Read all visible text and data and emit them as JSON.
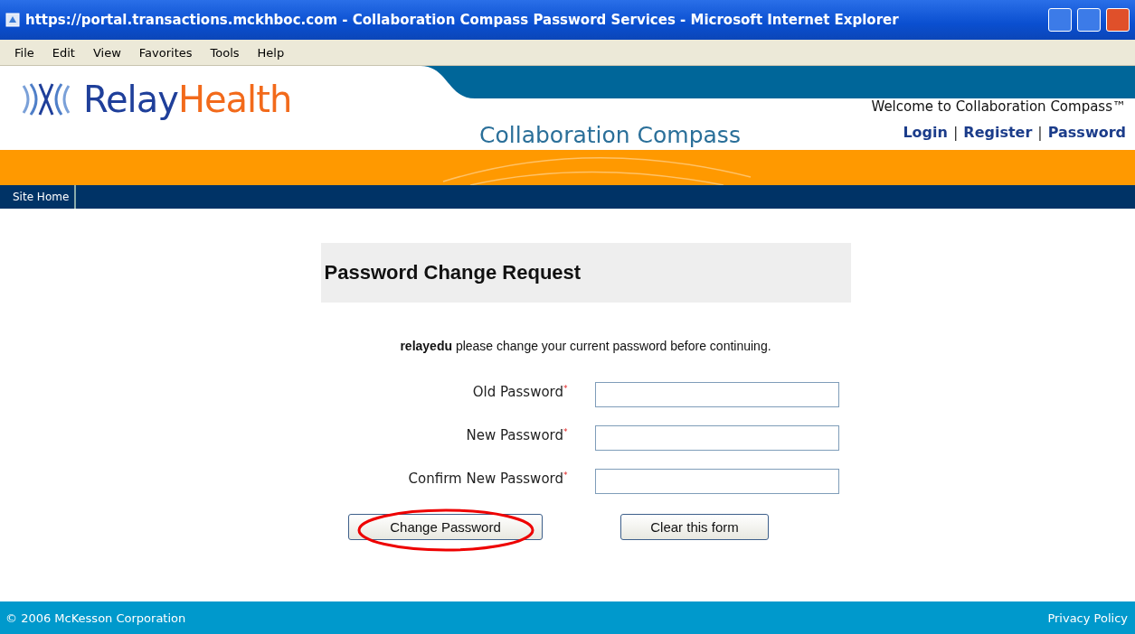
{
  "window": {
    "title": "https://portal.transactions.mckhboc.com - Collaboration Compass Password Services - Microsoft Internet Explorer"
  },
  "menu": [
    "File",
    "Edit",
    "View",
    "Favorites",
    "Tools",
    "Help"
  ],
  "header": {
    "logo_first": "Relay",
    "logo_second": "Health",
    "site_title": "Collaboration Compass",
    "welcome": "Welcome to Collaboration Compass™",
    "links": [
      "Login",
      "Register",
      "Password"
    ],
    "separator": "|"
  },
  "nav": [
    "Site Home"
  ],
  "form": {
    "title": "Password Change Request",
    "message": "**relayedu** please change your current password before continuing.",
    "fields": [
      {
        "label": "Old Password",
        "required_mark": "*"
      },
      {
        "label": "New Password",
        "required_mark": "*"
      },
      {
        "label": "Confirm New Password",
        "required_mark": "*"
      }
    ],
    "buttons": [
      {
        "label": "Change Password",
        "circled": true
      },
      {
        "label": "Clear this form",
        "circled": false
      }
    ]
  },
  "footer": {
    "copyright": "© 2006 McKesson Corporation",
    "link": "Privacy Policy"
  }
}
